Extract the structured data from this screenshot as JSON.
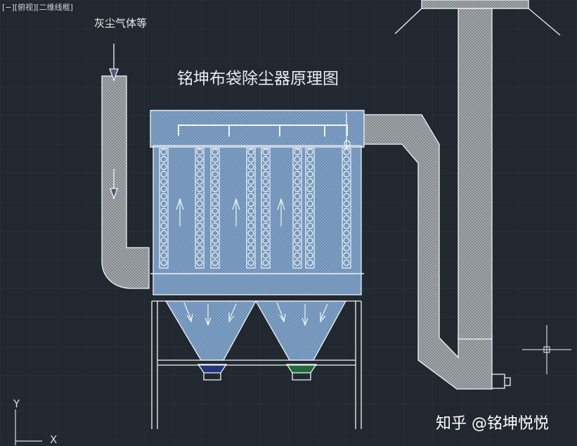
{
  "viewport": {
    "label": "[−][俯视][二维线框]"
  },
  "drawing": {
    "title": "铭坤布袋除尘器原理图",
    "inlet_label": "灰尘气体等"
  },
  "watermark": {
    "text": "知乎 @铭坤悦悦"
  },
  "ucs": {
    "y_label": "Y",
    "x_label": "X"
  },
  "colors": {
    "background": "#212830",
    "grid": "#2b333c",
    "duct_fill": "#a9aeb2",
    "body_fill": "#7ea0c4",
    "line": "#f2f4f6",
    "hopper_left": "#24357a",
    "hopper_right": "#1f6a3d"
  },
  "icons": {
    "crosshair": "crosshair-icon",
    "ucs": "ucs-icon"
  }
}
